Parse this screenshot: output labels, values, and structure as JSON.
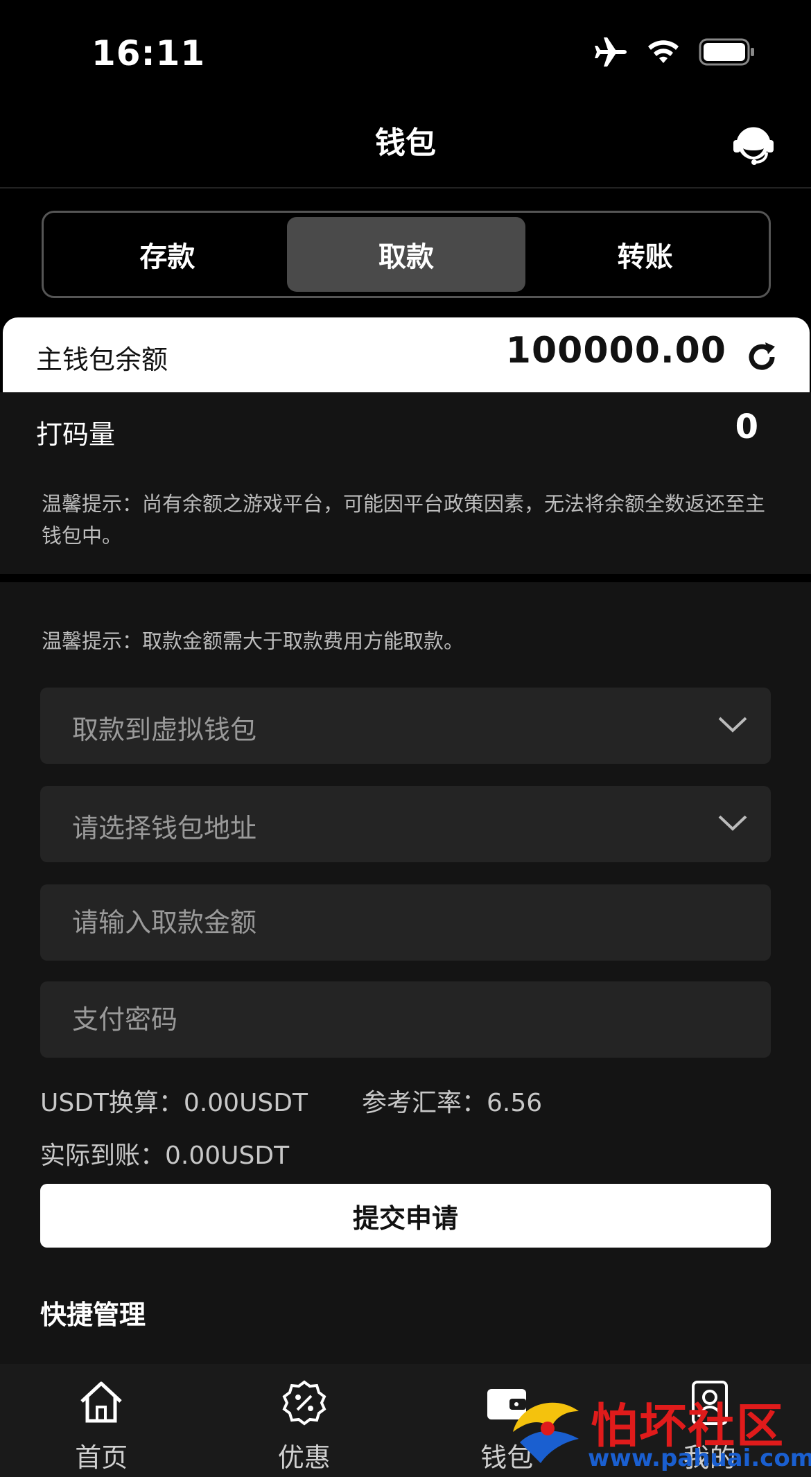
{
  "status_bar": {
    "time": "16:11"
  },
  "header": {
    "title": "钱包"
  },
  "tabs": [
    {
      "label": "存款"
    },
    {
      "label": "取款"
    },
    {
      "label": "转账"
    }
  ],
  "balance": {
    "label": "主钱包余额",
    "value": "100000.00"
  },
  "turnover": {
    "label": "打码量",
    "value": "0"
  },
  "tip_platform": "温馨提示：尚有余额之游戏平台，可能因平台政策因素，无法将余额全数返还至主钱包中。",
  "tip_withdraw": "温馨提示：取款金额需大于取款费用方能取款。",
  "form": {
    "method_select": "取款到虚拟钱包",
    "address_select": "请选择钱包地址",
    "amount_placeholder": "请输入取款金额",
    "password_placeholder": "支付密码"
  },
  "conversion": {
    "usdt_label": "USDT换算：0.00USDT",
    "rate_label": "参考汇率：6.56",
    "actual_label": "实际到账：0.00USDT"
  },
  "submit_label": "提交申请",
  "quick_manage_title": "快捷管理",
  "bottom_nav": [
    {
      "label": "首页",
      "icon": "home-icon"
    },
    {
      "label": "优惠",
      "icon": "discount-icon"
    },
    {
      "label": "钱包",
      "icon": "wallet-icon"
    },
    {
      "label": "我的",
      "icon": "profile-icon"
    }
  ],
  "watermark": {
    "text": "怕坏社区",
    "url": "www.pahuai.com"
  }
}
